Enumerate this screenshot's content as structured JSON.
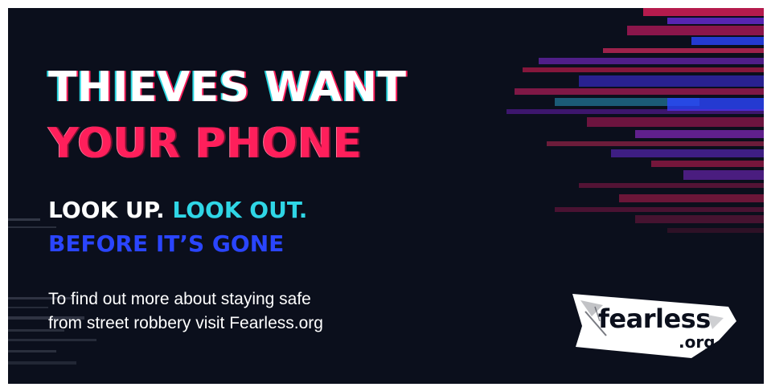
{
  "headline": {
    "line1": "THIEVES WANT",
    "line2": "YOUR PHONE"
  },
  "tagline": {
    "look_up": "LOOK UP.",
    "look_out": "LOOK OUT.",
    "before_gone": "BEFORE IT’S GONE"
  },
  "info": {
    "line1": "To find out more about staying safe",
    "line2": "from street robbery visit Fearless.org"
  },
  "logo": {
    "main": "fearless",
    "sub": ".org"
  },
  "colors": {
    "background": "#0b0f1c",
    "headline_white": "#ffffff",
    "headline_pink": "#ff1f5b",
    "look_out_cyan": "#2fd6e6",
    "before_gone_blue": "#2a45ff"
  }
}
